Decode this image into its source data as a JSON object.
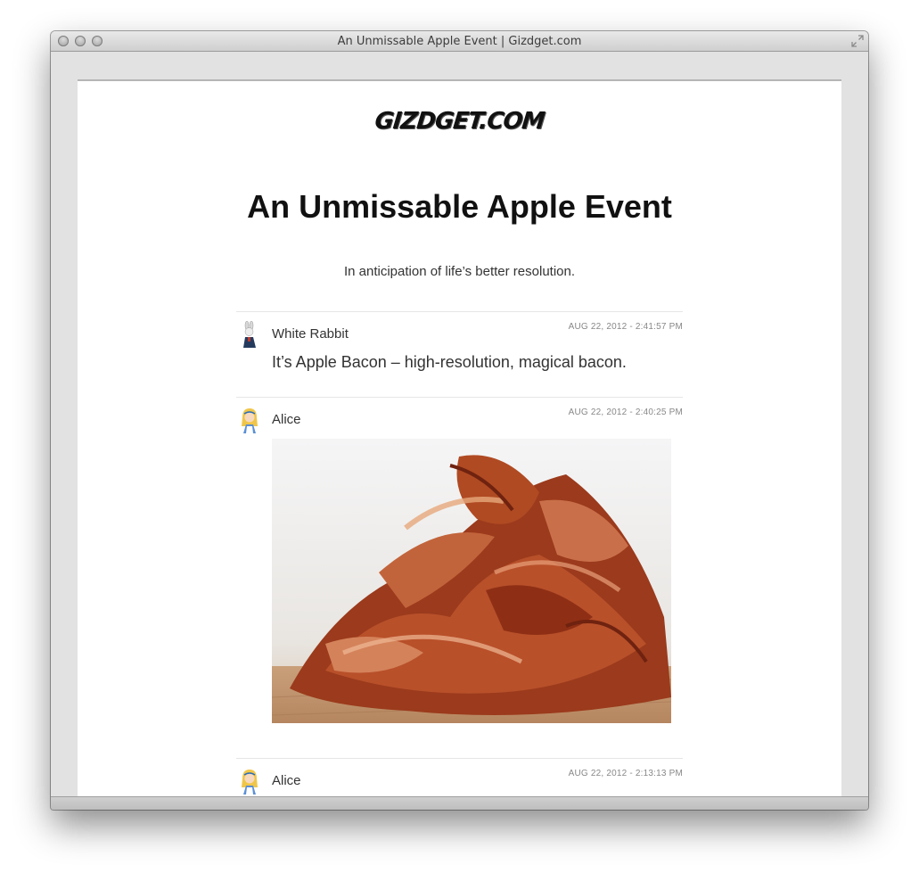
{
  "window": {
    "title": "An Unmissable Apple Event | Gizdget.com"
  },
  "site": {
    "logo": "GIZDGET.COM",
    "headline": "An Unmissable Apple Event",
    "tagline": "In anticipation of life’s better resolution."
  },
  "posts": [
    {
      "author": "White Rabbit",
      "timestamp": "AUG 22, 2012 - 2:41:57 PM",
      "text": "It’s Apple Bacon – high-resolution, magical bacon.",
      "avatar": "white-rabbit-avatar"
    },
    {
      "author": "Alice",
      "timestamp": "AUG 22, 2012 - 2:40:25 PM",
      "image": "bacon-photo",
      "avatar": "alice-avatar"
    },
    {
      "author": "Alice",
      "timestamp": "AUG 22, 2012 - 2:13:13 PM",
      "avatar": "alice-avatar"
    }
  ],
  "colors": {
    "page_background": "#ffffff",
    "chrome": "#e2e2e2",
    "text": "#333333",
    "timestamp": "#888888"
  }
}
